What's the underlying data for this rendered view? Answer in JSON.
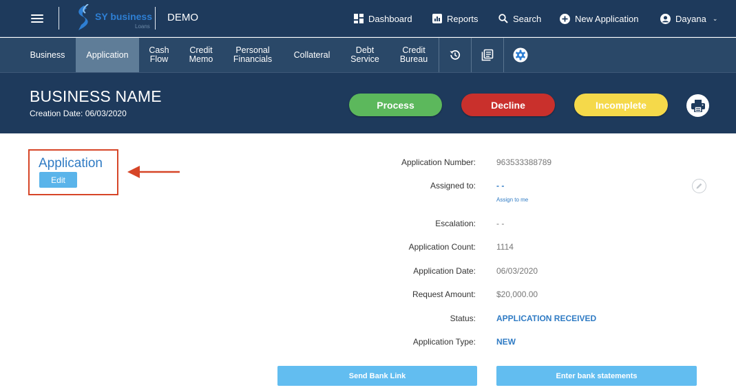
{
  "topbar": {
    "brand_name": "SY business",
    "brand_sub": "Loans",
    "environment": "DEMO",
    "nav": [
      {
        "label": "Dashboard",
        "icon": "dashboard-icon"
      },
      {
        "label": "Reports",
        "icon": "reports-icon"
      },
      {
        "label": "Search",
        "icon": "search-icon"
      },
      {
        "label": "New Application",
        "icon": "plus-circle-icon"
      },
      {
        "label": "Dayana",
        "icon": "user-icon"
      }
    ]
  },
  "tabs": [
    {
      "label": "Business"
    },
    {
      "label": "Application"
    },
    {
      "label": "Cash\nFlow"
    },
    {
      "label": "Credit\nMemo"
    },
    {
      "label": "Personal\nFinancials"
    },
    {
      "label": "Collateral"
    },
    {
      "label": "Debt\nService"
    },
    {
      "label": "Credit\nBureau"
    }
  ],
  "tab_icons": [
    "history-icon",
    "documents-icon",
    "settings-icon"
  ],
  "header": {
    "business_name": "BUSINESS NAME",
    "creation_date": "Creation Date: 06/03/2020",
    "process_label": "Process",
    "decline_label": "Decline",
    "incomplete_label": "Incomplete"
  },
  "section": {
    "title": "Application",
    "edit_label": "Edit"
  },
  "details": {
    "rows": [
      {
        "label": "Application Number:",
        "value": "963533388789"
      },
      {
        "label": "Assigned to:",
        "value": "- -"
      },
      {
        "label": "Escalation:",
        "value": "- -"
      },
      {
        "label": "Application Count:",
        "value": "1114"
      },
      {
        "label": "Application Date:",
        "value": "06/03/2020"
      },
      {
        "label": "Request Amount:",
        "value": "$20,000.00"
      },
      {
        "label": "Status:",
        "value": "APPLICATION RECEIVED"
      },
      {
        "label": "Application Type:",
        "value": "NEW"
      }
    ],
    "assign_link": "Assign to me"
  },
  "actions": {
    "send_bank_link": "Send Bank Link",
    "enter_bank_statements": "Enter bank statements"
  },
  "colors": {
    "navy": "#1e3a5c",
    "tab_bar": "#2a4868",
    "active_tab": "#5f7d98",
    "process": "#5cb85c",
    "decline": "#c9302c",
    "incomplete": "#f5d94a",
    "accent_blue": "#2f7bc4",
    "highlight_red": "#d64527"
  }
}
